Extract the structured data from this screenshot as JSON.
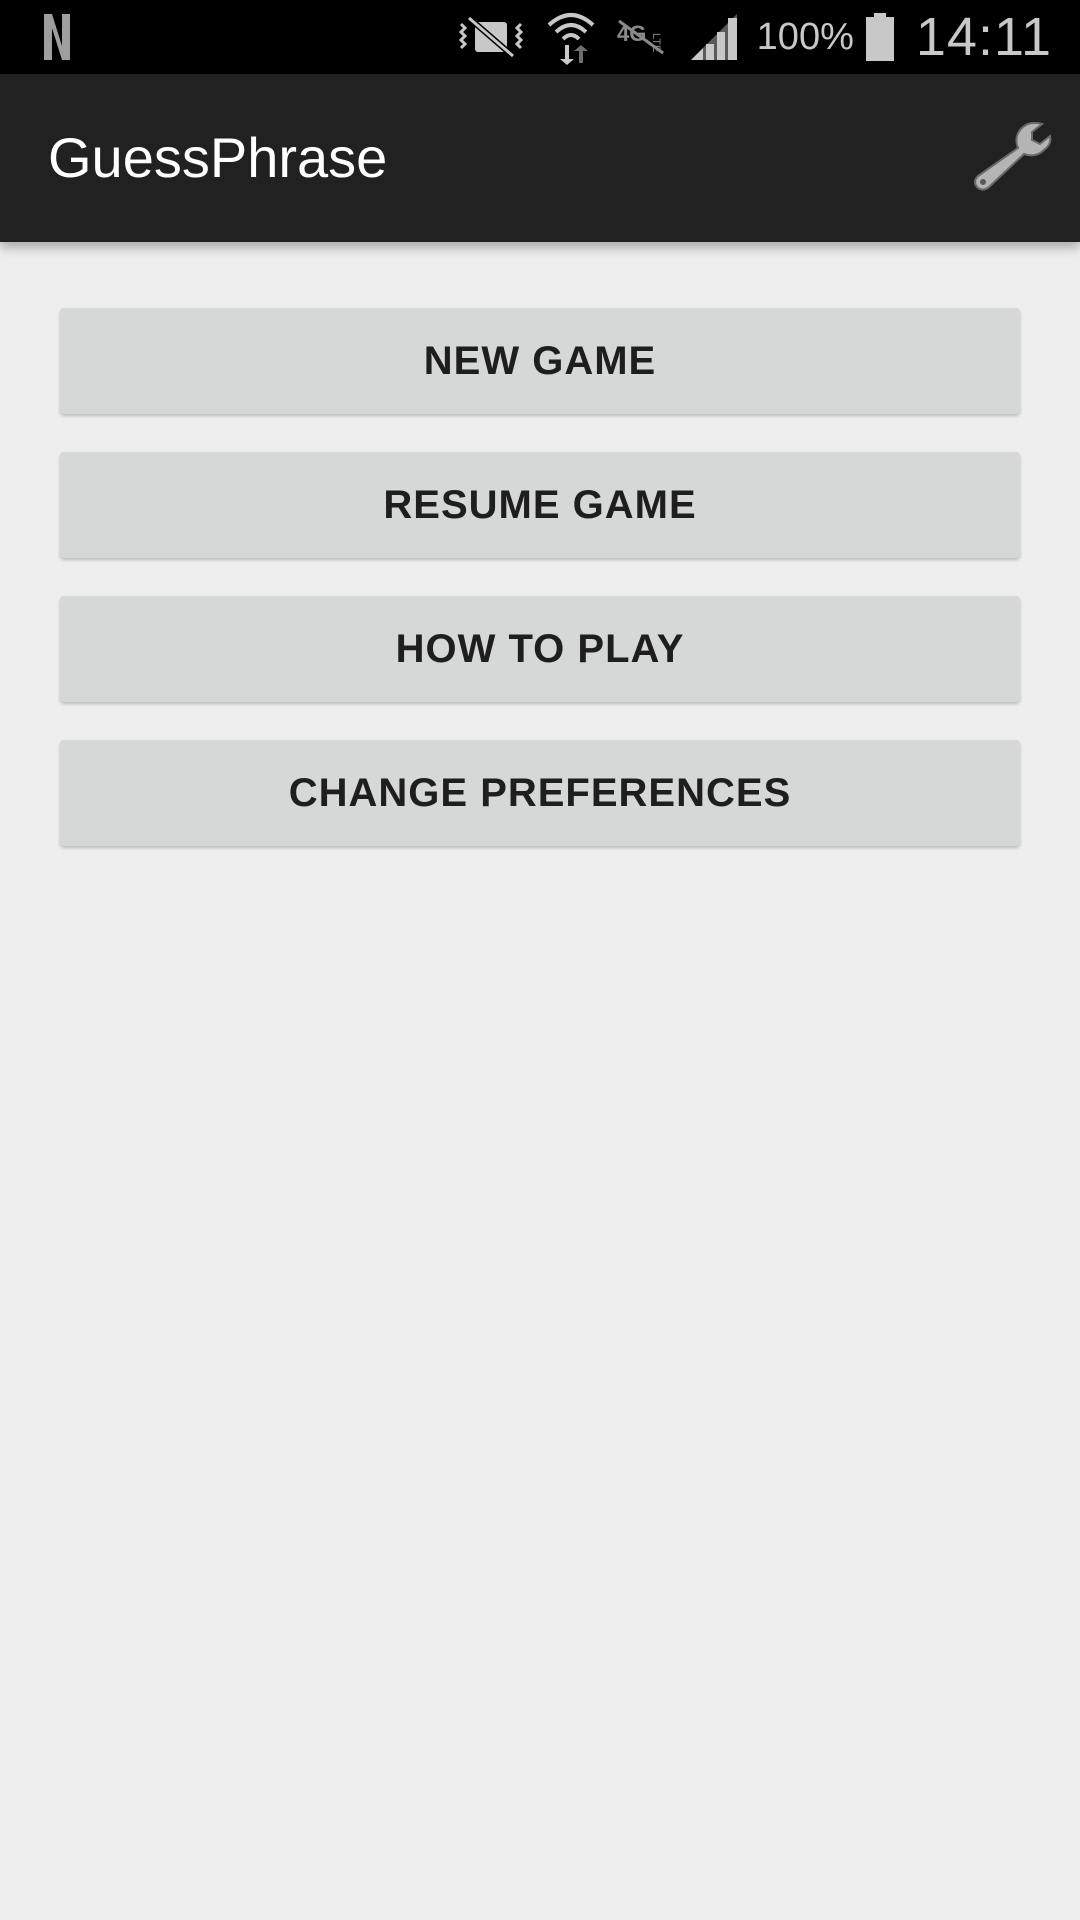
{
  "status_bar": {
    "notification_icon": "netflix-n-icon",
    "icons": [
      "vibrate-mute-icon",
      "wifi-icon",
      "lte-off-icon",
      "signal-icon"
    ],
    "battery": "100%",
    "time": "14:11"
  },
  "app_bar": {
    "title": "GuessPhrase",
    "settings_icon": "wrench-icon"
  },
  "menu": {
    "new_game": "NEW GAME",
    "resume_game": "RESUME GAME",
    "how_to_play": "HOW TO PLAY",
    "change_preferences": "CHANGE PREFERENCES"
  },
  "colors": {
    "status_bar_bg": "#000000",
    "app_bar_bg": "#212121",
    "page_bg": "#eeeeee",
    "button_bg": "#d6d7d7",
    "button_text": "#1e1e1e"
  }
}
